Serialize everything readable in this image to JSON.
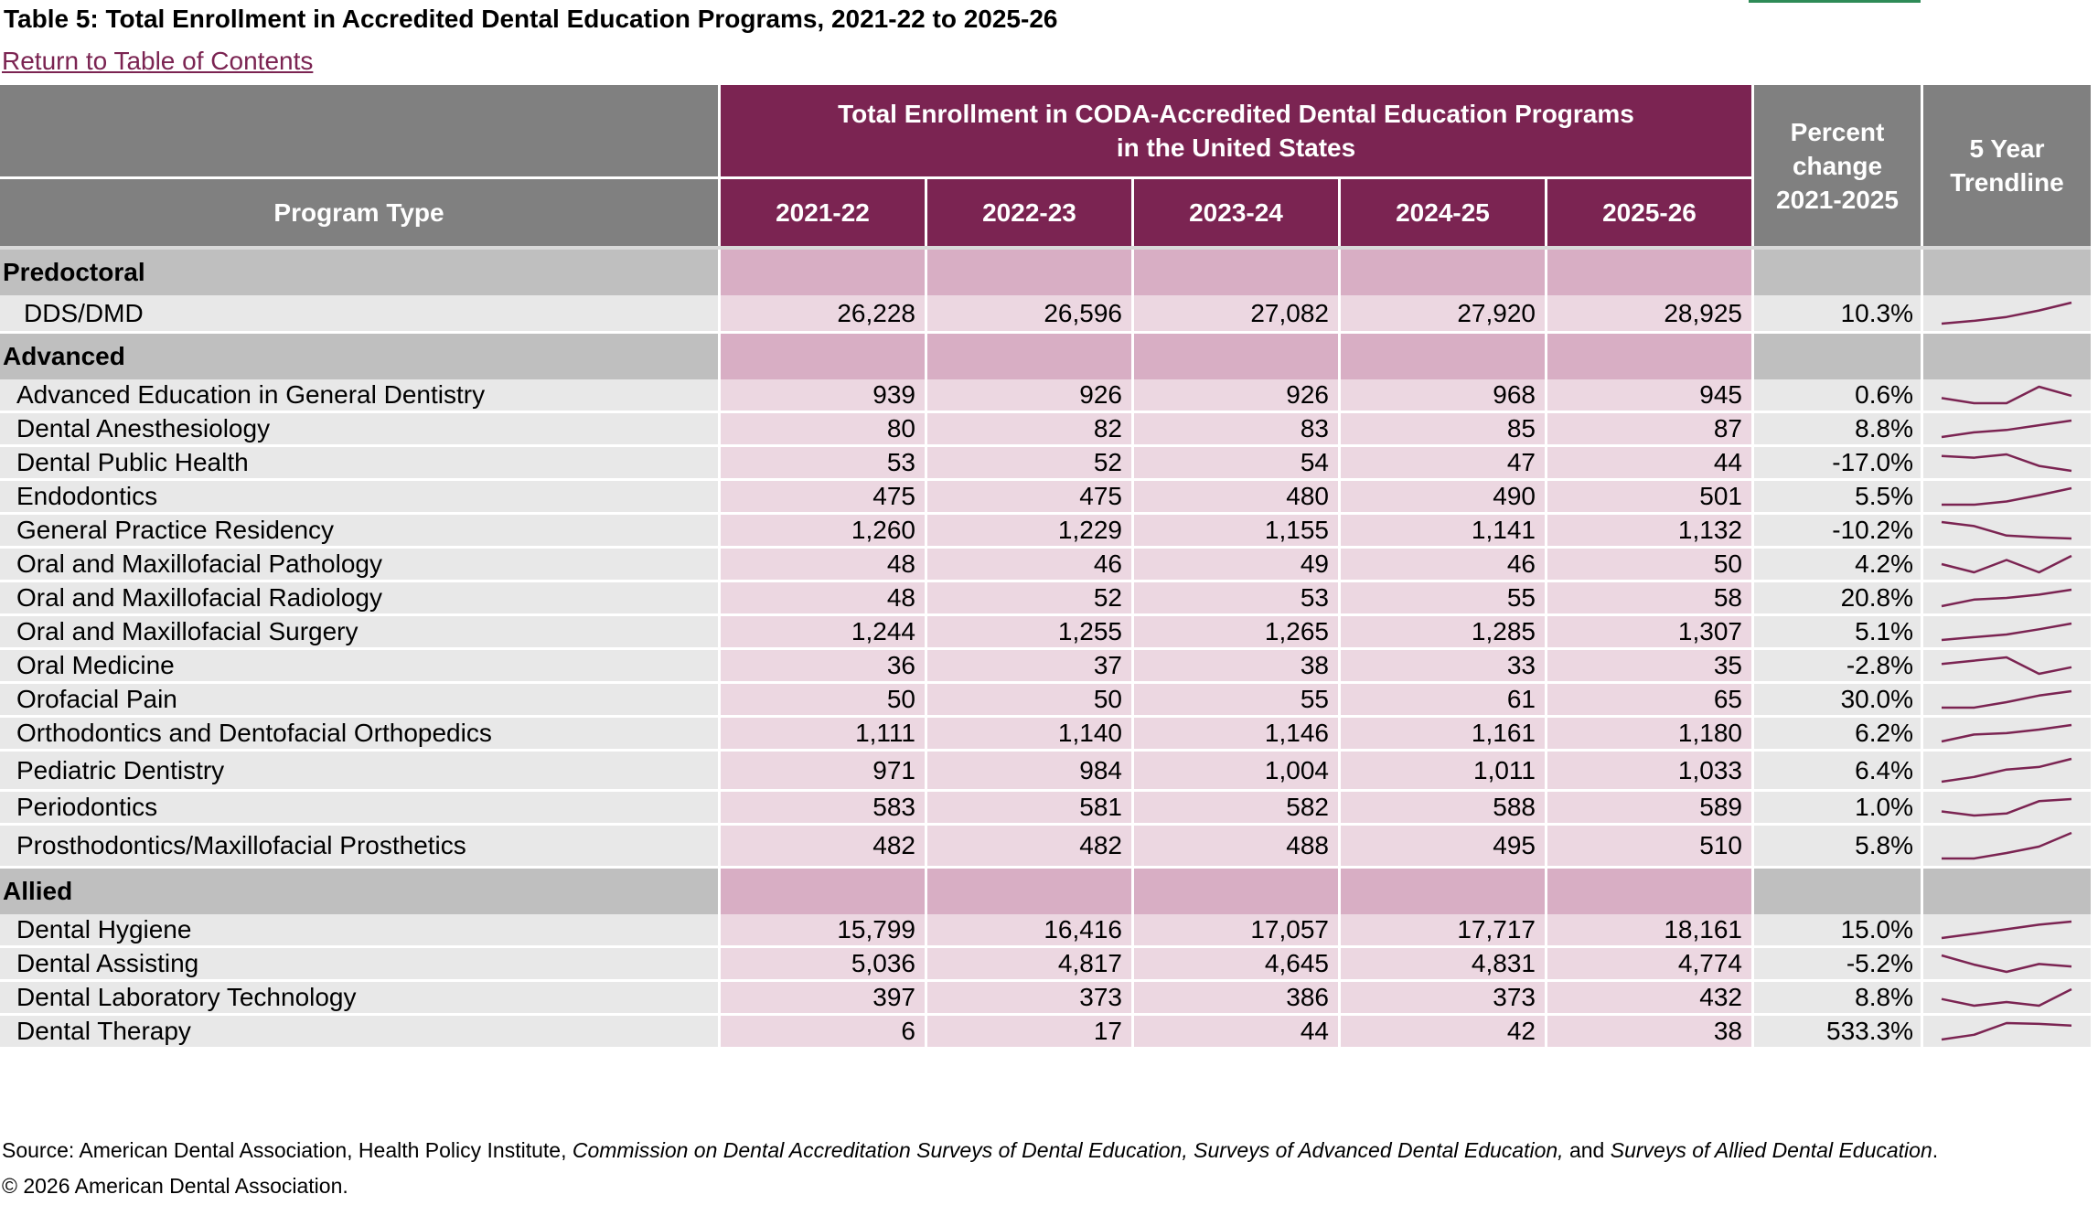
{
  "title": "Table 5: Total Enrollment in Accredited Dental Education Programs, 2021-22 to 2025-26",
  "toc_link": "Return to Table of Contents",
  "header": {
    "program_type": "Program Type",
    "group_line1": "Total Enrollment in CODA-Accredited Dental Education Programs",
    "group_line2": "in the United States",
    "years": [
      "2021-22",
      "2022-23",
      "2023-24",
      "2024-25",
      "2025-26"
    ],
    "pct_line1": "Percent",
    "pct_line2": "change",
    "pct_line3": "2021-2025",
    "trend_line1": "5 Year",
    "trend_line2": "Trendline"
  },
  "colors": {
    "maroon": "#7b2452",
    "header_grey": "#808080",
    "section_grey": "#bfbfbf",
    "section_pink": "#d8aec4",
    "value_pink": "#ecd7e1",
    "row_grey": "#e8e8e8"
  },
  "sections": [
    {
      "name": "Predoctoral",
      "rows": [
        {
          "program": "DDS/DMD",
          "values": [
            "26,228",
            "26,596",
            "27,082",
            "27,920",
            "28,925"
          ],
          "series": [
            26228,
            26596,
            27082,
            27920,
            28925
          ],
          "pct": "10.3%"
        }
      ]
    },
    {
      "name": "Advanced",
      "rows": [
        {
          "program": "Advanced Education in General Dentistry",
          "values": [
            "939",
            "926",
            "926",
            "968",
            "945"
          ],
          "series": [
            939,
            926,
            926,
            968,
            945
          ],
          "pct": "0.6%"
        },
        {
          "program": "Dental Anesthesiology",
          "values": [
            "80",
            "82",
            "83",
            "85",
            "87"
          ],
          "series": [
            80,
            82,
            83,
            85,
            87
          ],
          "pct": "8.8%"
        },
        {
          "program": "Dental Public Health",
          "values": [
            "53",
            "52",
            "54",
            "47",
            "44"
          ],
          "series": [
            53,
            52,
            54,
            47,
            44
          ],
          "pct": "-17.0%"
        },
        {
          "program": "Endodontics",
          "values": [
            "475",
            "475",
            "480",
            "490",
            "501"
          ],
          "series": [
            475,
            475,
            480,
            490,
            501
          ],
          "pct": "5.5%"
        },
        {
          "program": "General Practice Residency",
          "values": [
            "1,260",
            "1,229",
            "1,155",
            "1,141",
            "1,132"
          ],
          "series": [
            1260,
            1229,
            1155,
            1141,
            1132
          ],
          "pct": "-10.2%"
        },
        {
          "program": "Oral and Maxillofacial Pathology",
          "values": [
            "48",
            "46",
            "49",
            "46",
            "50"
          ],
          "series": [
            48,
            46,
            49,
            46,
            50
          ],
          "pct": "4.2%"
        },
        {
          "program": "Oral and Maxillofacial Radiology",
          "values": [
            "48",
            "52",
            "53",
            "55",
            "58"
          ],
          "series": [
            48,
            52,
            53,
            55,
            58
          ],
          "pct": "20.8%"
        },
        {
          "program": "Oral and Maxillofacial Surgery",
          "values": [
            "1,244",
            "1,255",
            "1,265",
            "1,285",
            "1,307"
          ],
          "series": [
            1244,
            1255,
            1265,
            1285,
            1307
          ],
          "pct": "5.1%"
        },
        {
          "program": "Oral Medicine",
          "values": [
            "36",
            "37",
            "38",
            "33",
            "35"
          ],
          "series": [
            36,
            37,
            38,
            33,
            35
          ],
          "pct": "-2.8%"
        },
        {
          "program": "Orofacial Pain",
          "values": [
            "50",
            "50",
            "55",
            "61",
            "65"
          ],
          "series": [
            50,
            50,
            55,
            61,
            65
          ],
          "pct": "30.0%"
        },
        {
          "program": "Orthodontics and Dentofacial Orthopedics",
          "values": [
            "1,111",
            "1,140",
            "1,146",
            "1,161",
            "1,180"
          ],
          "series": [
            1111,
            1140,
            1146,
            1161,
            1180
          ],
          "pct": "6.2%"
        },
        {
          "program": "Pediatric Dentistry",
          "values": [
            "971",
            "984",
            "1,004",
            "1,011",
            "1,033"
          ],
          "series": [
            971,
            984,
            1004,
            1011,
            1033
          ],
          "pct": "6.4%"
        },
        {
          "program": "Periodontics",
          "values": [
            "583",
            "581",
            "582",
            "588",
            "589"
          ],
          "series": [
            583,
            581,
            582,
            588,
            589
          ],
          "pct": "1.0%"
        },
        {
          "program": "Prosthodontics/Maxillofacial Prosthetics",
          "values": [
            "482",
            "482",
            "488",
            "495",
            "510"
          ],
          "series": [
            482,
            482,
            488,
            495,
            510
          ],
          "pct": "5.8%"
        }
      ]
    },
    {
      "name": "Allied",
      "rows": [
        {
          "program": "Dental Hygiene",
          "values": [
            "15,799",
            "16,416",
            "17,057",
            "17,717",
            "18,161"
          ],
          "series": [
            15799,
            16416,
            17057,
            17717,
            18161
          ],
          "pct": "15.0%"
        },
        {
          "program": "Dental Assisting",
          "values": [
            "5,036",
            "4,817",
            "4,645",
            "4,831",
            "4,774"
          ],
          "series": [
            5036,
            4817,
            4645,
            4831,
            4774
          ],
          "pct": "-5.2%"
        },
        {
          "program": "Dental Laboratory Technology",
          "values": [
            "397",
            "373",
            "386",
            "373",
            "432"
          ],
          "series": [
            397,
            373,
            386,
            373,
            432
          ],
          "pct": "8.8%"
        },
        {
          "program": "Dental Therapy",
          "values": [
            "6",
            "17",
            "44",
            "42",
            "38"
          ],
          "series": [
            6,
            17,
            44,
            42,
            38
          ],
          "pct": "533.3%"
        }
      ]
    }
  ],
  "source": {
    "prefix": "Source: American Dental Association, Health Policy Institute, ",
    "italic1": "Commission on Dental Accreditation Surveys of Dental Education, Surveys of Advanced Dental Education,",
    "mid": " and ",
    "italic2": "Surveys of Allied Dental Education",
    "suffix": "."
  },
  "copyright": "© 2026 American Dental Association."
}
